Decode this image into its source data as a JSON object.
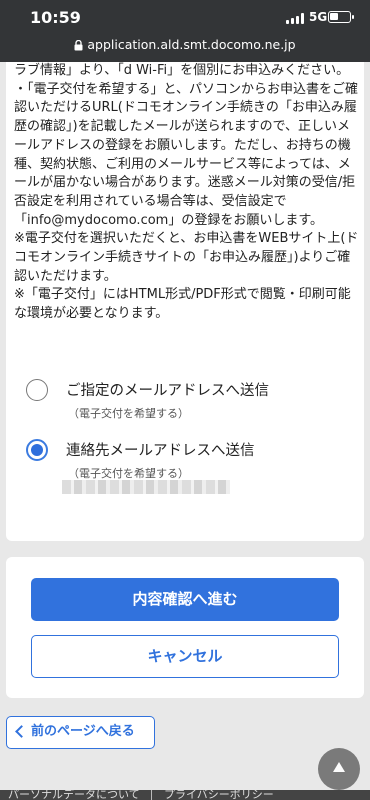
{
  "status_bar": {
    "time": "10:59",
    "network": "5G"
  },
  "browser": {
    "url": "application.ald.smt.docomo.ne.jp"
  },
  "body_text": [
    "ラブ情報」より、「d Wi-Fi」を個別にお申込みください。",
    "・「電子交付を希望する」と、パソコンからお申込書をご確認いただけるURL(ドコモオンライン手続きの「お申込み履歴の確認」)を記載したメールが送られますので、正しいメールアドレスの登録をお願いします。ただし、お持ちの機種、契約状態、ご利用のメールサービス等によっては、メールが届かない場合があります。迷惑メール対策の受信/拒否設定を利用されている場合等は、受信設定で「info@mydocomo.com」の登録をお願いします。",
    "※電子交付を選択いただくと、お申込書をWEBサイト上(ドコモオンライン手続きサイトの「お申込み履歴」)よりご確認いただけます。",
    "※「電子交付」にはHTML形式/PDF形式で閲覧・印刷可能な環境が必要となります。"
  ],
  "options": [
    {
      "label": "ご指定のメールアドレスへ送信",
      "sub": "（電子交付を希望する）",
      "selected": false
    },
    {
      "label": "連絡先メールアドレスへ送信",
      "sub": "（電子交付を希望する）",
      "selected": true
    }
  ],
  "buttons": {
    "confirm": "内容確認へ進む",
    "cancel": "キャンセル",
    "back": "前のページへ戻る"
  },
  "footer": {
    "link1": "パーソナルデータについて",
    "link2": "プライバシーポリシー"
  },
  "colors": {
    "accent": "#3172dd",
    "chrome": "#333537"
  }
}
